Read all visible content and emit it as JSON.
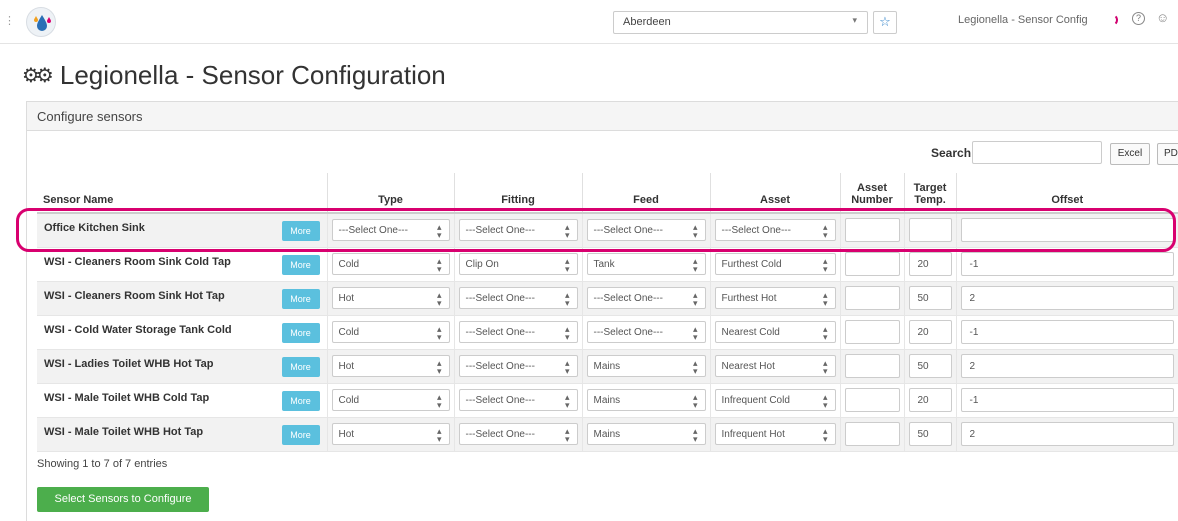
{
  "topbar": {
    "site": "Aberdeen",
    "breadcrumb_title": "Legionella - Sensor Config",
    "colors": {
      "spinner": "#d0006f",
      "star": "#2e80c8"
    }
  },
  "page": {
    "title": "Legionella - Sensor Configuration"
  },
  "panel": {
    "title": "Configure sensors"
  },
  "toolbar": {
    "search_label": "Search:",
    "search_value": "",
    "excel_label": "Excel",
    "pdf_label": "PD"
  },
  "table": {
    "columns": [
      "Sensor Name",
      "Type",
      "Fitting",
      "Feed",
      "Asset",
      "Asset Number",
      "Target Temp.",
      "Offset"
    ],
    "more_label": "More",
    "rows": [
      {
        "name": "Office Kitchen Sink",
        "type": "---Select One---",
        "fitting": "---Select One---",
        "feed": "---Select One---",
        "asset": "---Select One---",
        "asset_number": "",
        "target_temp": "",
        "offset": ""
      },
      {
        "name": "WSI - Cleaners Room Sink Cold Tap",
        "type": "Cold",
        "fitting": "Clip On",
        "feed": "Tank",
        "asset": "Furthest Cold",
        "asset_number": "",
        "target_temp": "20",
        "offset": "-1"
      },
      {
        "name": "WSI - Cleaners Room Sink Hot Tap",
        "type": "Hot",
        "fitting": "---Select One---",
        "feed": "---Select One---",
        "asset": "Furthest Hot",
        "asset_number": "",
        "target_temp": "50",
        "offset": "2"
      },
      {
        "name": "WSI - Cold Water Storage Tank Cold",
        "type": "Cold",
        "fitting": "---Select One---",
        "feed": "---Select One---",
        "asset": "Nearest Cold",
        "asset_number": "",
        "target_temp": "20",
        "offset": "-1"
      },
      {
        "name": "WSI - Ladies Toilet WHB Hot Tap",
        "type": "Hot",
        "fitting": "---Select One---",
        "feed": "Mains",
        "asset": "Nearest Hot",
        "asset_number": "",
        "target_temp": "50",
        "offset": "2"
      },
      {
        "name": "WSI - Male Toilet WHB Cold Tap",
        "type": "Cold",
        "fitting": "---Select One---",
        "feed": "Mains",
        "asset": "Infrequent Cold",
        "asset_number": "",
        "target_temp": "20",
        "offset": "-1"
      },
      {
        "name": "WSI - Male Toilet WHB Hot Tap",
        "type": "Hot",
        "fitting": "---Select One---",
        "feed": "Mains",
        "asset": "Infrequent Hot",
        "asset_number": "",
        "target_temp": "50",
        "offset": "2"
      }
    ]
  },
  "footer": {
    "showing": "Showing 1 to 7 of 7 entries",
    "configure_button": "Select Sensors to Configure"
  },
  "colors": {
    "more_button": "#5bc0de",
    "configure_button": "#4cae4c",
    "highlight": "#d8006f"
  }
}
